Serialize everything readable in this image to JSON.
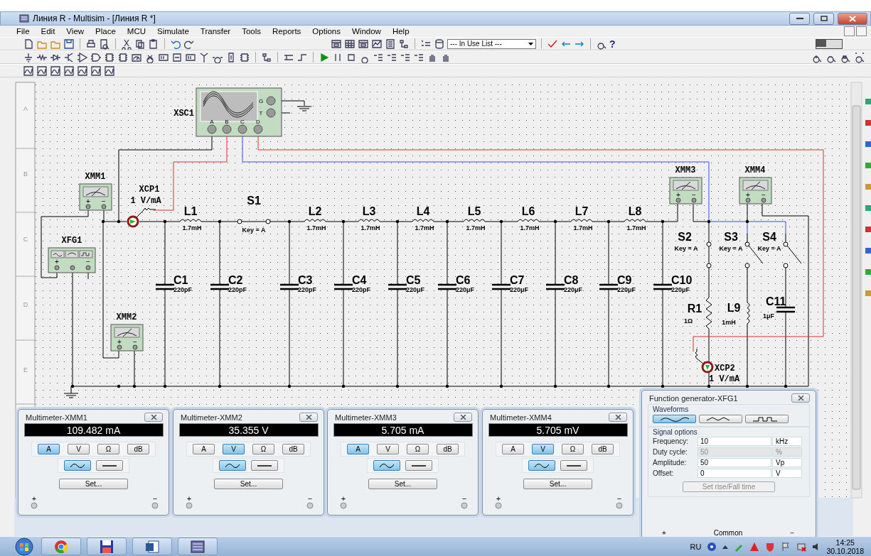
{
  "window": {
    "title": "Линия R - Multisim - [Линия R *]"
  },
  "menu": [
    "File",
    "Edit",
    "View",
    "Place",
    "MCU",
    "Simulate",
    "Transfer",
    "Tools",
    "Reports",
    "Options",
    "Window",
    "Help"
  ],
  "toolbar": {
    "in_use_list": "--- In Use List ---",
    "help": "?",
    "simulation_on": false
  },
  "schematic": {
    "ruler": [
      "A",
      "B",
      "C",
      "D",
      "E"
    ],
    "parts": [
      {
        "kind": "oscilloscope",
        "name": "XSC1",
        "pins": [
          "A",
          "B",
          "C",
          "D",
          "G",
          "T"
        ]
      },
      {
        "kind": "multimeter",
        "name": "XMM1",
        "terminals": [
          "+",
          "−"
        ]
      },
      {
        "kind": "probe",
        "name": "XCP1",
        "value": "1 V/mA"
      },
      {
        "kind": "inductor",
        "name": "L1",
        "value": "1.7mH"
      },
      {
        "kind": "switch",
        "name": "S1",
        "value": "Key = A",
        "closed": true
      },
      {
        "kind": "inductor",
        "name": "L2",
        "value": "1.7mH"
      },
      {
        "kind": "inductor",
        "name": "L3",
        "value": "1.7mH"
      },
      {
        "kind": "inductor",
        "name": "L4",
        "value": "1.7mH"
      },
      {
        "kind": "inductor",
        "name": "L5",
        "value": "1.7mH"
      },
      {
        "kind": "inductor",
        "name": "L6",
        "value": "1.7mH"
      },
      {
        "kind": "inductor",
        "name": "L7",
        "value": "1.7mH"
      },
      {
        "kind": "inductor",
        "name": "L8",
        "value": "1.7mH"
      },
      {
        "kind": "multimeter",
        "name": "XMM3",
        "terminals": [
          "+",
          "−"
        ]
      },
      {
        "kind": "multimeter",
        "name": "XMM4",
        "terminals": [
          "+",
          "−"
        ]
      },
      {
        "kind": "generator",
        "name": "XFG1",
        "terminals": [
          "+",
          "−"
        ]
      },
      {
        "kind": "switch",
        "name": "S2",
        "value": "Key = A",
        "closed": true
      },
      {
        "kind": "switch",
        "name": "S3",
        "value": "Key = A",
        "closed": false
      },
      {
        "kind": "switch",
        "name": "S4",
        "value": "Key = A",
        "closed": false
      },
      {
        "kind": "capacitor",
        "name": "C1",
        "value": "220pF"
      },
      {
        "kind": "capacitor",
        "name": "C2",
        "value": "220pF"
      },
      {
        "kind": "capacitor",
        "name": "C3",
        "value": "220pF"
      },
      {
        "kind": "capacitor",
        "name": "C4",
        "value": "220pF"
      },
      {
        "kind": "capacitor",
        "name": "C5",
        "value": "220μF"
      },
      {
        "kind": "capacitor",
        "name": "C6",
        "value": "220μF"
      },
      {
        "kind": "capacitor",
        "name": "C7",
        "value": "220μF"
      },
      {
        "kind": "capacitor",
        "name": "C8",
        "value": "220μF"
      },
      {
        "kind": "capacitor",
        "name": "C9",
        "value": "220μF"
      },
      {
        "kind": "capacitor",
        "name": "C10",
        "value": "220μF"
      },
      {
        "kind": "resistor",
        "name": "R1",
        "value": "1Ω"
      },
      {
        "kind": "inductor",
        "name": "L9",
        "value": "1mH"
      },
      {
        "kind": "capacitor",
        "name": "C11",
        "value": "1μF"
      },
      {
        "kind": "multimeter",
        "name": "XMM2",
        "terminals": [
          "+",
          "−"
        ]
      },
      {
        "kind": "probe",
        "name": "XCP2",
        "value": "1 V/mA"
      }
    ]
  },
  "multimeters": [
    {
      "title": "Multimeter-XMM1",
      "reading": "109.482 mA",
      "modes": [
        {
          "label": "A",
          "selected": true
        },
        {
          "label": "V",
          "selected": false
        },
        {
          "label": "Ω",
          "selected": false
        },
        {
          "label": "dB",
          "selected": false
        }
      ],
      "signals": [
        {
          "kind": "ac",
          "selected": true
        },
        {
          "kind": "dc",
          "selected": false
        }
      ],
      "set_button": "Set...",
      "plus": "+",
      "minus": "−"
    },
    {
      "title": "Multimeter-XMM2",
      "reading": "35.355 V",
      "modes": [
        {
          "label": "A",
          "selected": false
        },
        {
          "label": "V",
          "selected": true
        },
        {
          "label": "Ω",
          "selected": false
        },
        {
          "label": "dB",
          "selected": false
        }
      ],
      "signals": [
        {
          "kind": "ac",
          "selected": true
        },
        {
          "kind": "dc",
          "selected": false
        }
      ],
      "set_button": "Set...",
      "plus": "+",
      "minus": "−"
    },
    {
      "title": "Multimeter-XMM3",
      "reading": "5.705 mA",
      "modes": [
        {
          "label": "A",
          "selected": true
        },
        {
          "label": "V",
          "selected": false
        },
        {
          "label": "Ω",
          "selected": false
        },
        {
          "label": "dB",
          "selected": false
        }
      ],
      "signals": [
        {
          "kind": "ac",
          "selected": true
        },
        {
          "kind": "dc",
          "selected": false
        }
      ],
      "set_button": "Set...",
      "plus": "+",
      "minus": "−"
    },
    {
      "title": "Multimeter-XMM4",
      "reading": "5.705 mV",
      "modes": [
        {
          "label": "A",
          "selected": false
        },
        {
          "label": "V",
          "selected": true
        },
        {
          "label": "Ω",
          "selected": false
        },
        {
          "label": "dB",
          "selected": false
        }
      ],
      "signals": [
        {
          "kind": "ac",
          "selected": true
        },
        {
          "kind": "dc",
          "selected": false
        }
      ],
      "set_button": "Set...",
      "plus": "+",
      "minus": "−"
    }
  ],
  "function_generator": {
    "title": "Function generator-XFG1",
    "waveforms_label": "Waveforms",
    "waveforms": [
      {
        "kind": "sine",
        "selected": true
      },
      {
        "kind": "triangle",
        "selected": false
      },
      {
        "kind": "square",
        "selected": false
      }
    ],
    "options_label": "Signal options",
    "fields": [
      {
        "label": "Frequency:",
        "value": "10",
        "unit": "kHz",
        "disabled": false
      },
      {
        "label": "Duty cycle:",
        "value": "50",
        "unit": "%",
        "disabled": true
      },
      {
        "label": "Amplitude:",
        "value": "50",
        "unit": "Vp",
        "disabled": false
      },
      {
        "label": "Offset:",
        "value": "0",
        "unit": "V",
        "disabled": false
      }
    ],
    "rise_fall_button": {
      "label": "Set rise/Fall time",
      "disabled": true
    },
    "common": "Common",
    "plus": "+",
    "minus": "−"
  },
  "taskbar": {
    "language": "RU",
    "time": "14:25",
    "date": "30.10.2018"
  }
}
